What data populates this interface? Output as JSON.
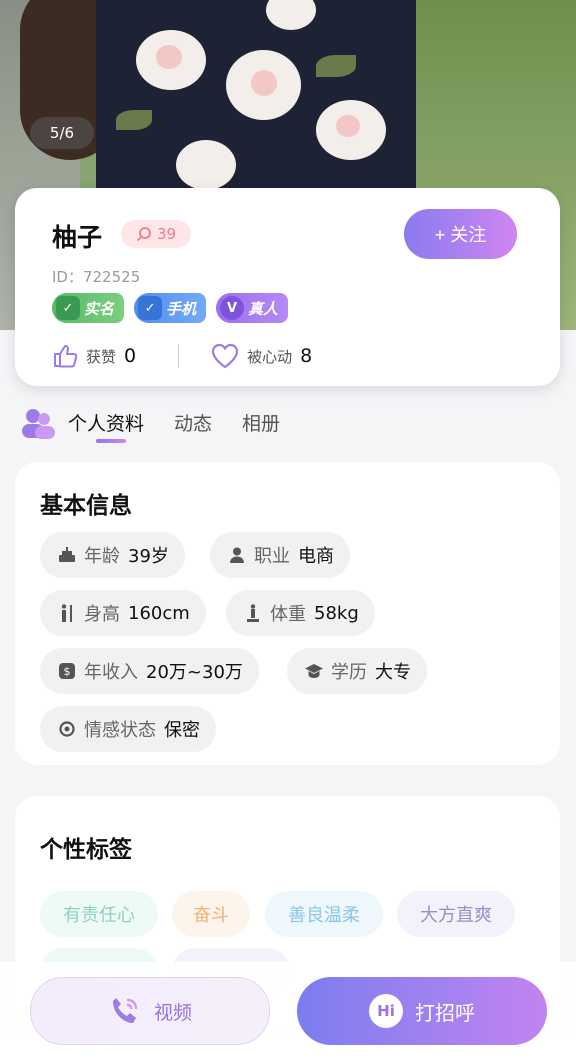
{
  "photo": {
    "counter": "5/6"
  },
  "profile": {
    "name": "柚子",
    "level": "39",
    "id_text": "ID：722525",
    "follow_label": "+ 关注",
    "badges": [
      "实名",
      "手机",
      "真人"
    ],
    "likes_label": "获赞",
    "likes_count": "0",
    "hearts_label": "被心动",
    "hearts_count": "8"
  },
  "tabs": [
    "个人资料",
    "动态",
    "相册"
  ],
  "basic_info": {
    "title": "基本信息",
    "items": [
      {
        "key": "年龄",
        "value": "39岁",
        "icon": "cake-icon"
      },
      {
        "key": "职业",
        "value": "电商",
        "icon": "person-icon"
      },
      {
        "key": "身高",
        "value": "160cm",
        "icon": "height-icon"
      },
      {
        "key": "体重",
        "value": "58kg",
        "icon": "weight-icon"
      },
      {
        "key": "年收入",
        "value": "20万~30万",
        "icon": "income-icon"
      },
      {
        "key": "学历",
        "value": "大专",
        "icon": "education-icon"
      },
      {
        "key": "情感状态",
        "value": "保密",
        "icon": "relationship-icon"
      }
    ]
  },
  "personality": {
    "title": "个性标签",
    "tags": [
      {
        "label": "有责任心",
        "color": "#8fd3b6",
        "bg": "#eefaf5"
      },
      {
        "label": "奋斗",
        "color": "#f0b27a",
        "bg": "#fdf4ec"
      },
      {
        "label": "善良温柔",
        "color": "#8cc6e6",
        "bg": "#eef7fc"
      },
      {
        "label": "大方直爽",
        "color": "#9a8fc8",
        "bg": "#f3f1fa"
      }
    ]
  },
  "actions": {
    "video": "视频",
    "greet": "打招呼",
    "greet_icon": "Hi"
  },
  "colors": {
    "accent_start": "#8a7bf0",
    "accent_end": "#d086f0"
  }
}
